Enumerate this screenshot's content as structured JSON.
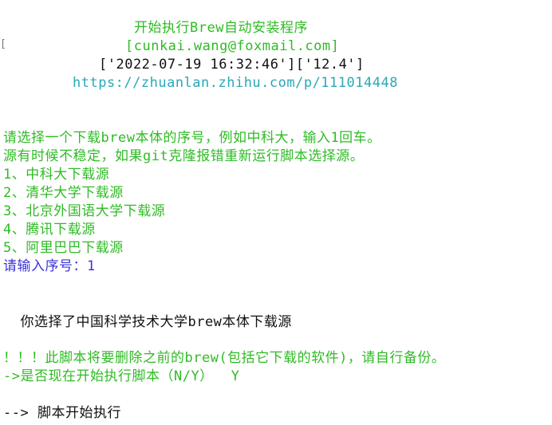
{
  "terminal": {
    "left_marker": "[",
    "banner": {
      "title": "开始执行Brew自动安装程序",
      "email": "[cunkai.wang@foxmail.com]",
      "meta": "['2022-07-19 16:32:46']['12.4']",
      "url": "https://zhuanlan.zhihu.com/p/111014448"
    },
    "prompt": {
      "line1": "请选择一个下载brew本体的序号，例如中科大，输入1回车。",
      "line2": "源有时候不稳定，如果git克隆报错重新运行脚本选择源。"
    },
    "options": [
      "1、中科大下载源",
      "2、清华大学下载源",
      "3、北京外国语大学下载源",
      "4、腾讯下载源",
      "5、阿里巴巴下载源"
    ],
    "input_prompt": "请输入序号：",
    "input_value": "1",
    "selected_message": "  你选择了中国科学技术大学brew本体下载源",
    "warning": "！！！此脚本将要删除之前的brew(包括它下载的软件)，请自行备份。",
    "confirm_prompt": "->是否现在开始执行脚本（N/Y）",
    "confirm_value": "Y",
    "start_message": "--> 脚本开始执行"
  },
  "colors": {
    "green": "#2fbb25",
    "cyan": "#2aa8b6",
    "blue": "#3a34d8",
    "black": "#111111",
    "background": "#ffffff"
  }
}
